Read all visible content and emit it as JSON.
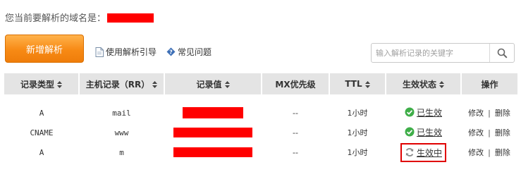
{
  "header": {
    "prompt": "您当前要解析的域名是："
  },
  "toolbar": {
    "add_label": "新增解析",
    "guide_label": "使用解析引导",
    "faq_label": "常见问题",
    "search_placeholder": "输入解析记录的关键字"
  },
  "table": {
    "columns": [
      "记录类型",
      "主机记录（RR）",
      "记录值",
      "MX优先级",
      "TTL",
      "生效状态",
      "操作"
    ],
    "rows": [
      {
        "type": "A",
        "host": "mail",
        "mx": "--",
        "ttl": "1小时",
        "status": "已生效",
        "edit": "修改",
        "divider": "|",
        "delete": "删除"
      },
      {
        "type": "CNAME",
        "host": "www",
        "mx": "--",
        "ttl": "1小时",
        "status": "已生效",
        "edit": "修改",
        "divider": "|",
        "delete": "删除"
      },
      {
        "type": "A",
        "host": "m",
        "mx": "--",
        "ttl": "1小时",
        "status": "生效中",
        "edit": "修改",
        "divider": "|",
        "delete": "删除"
      }
    ]
  },
  "colors": {
    "accent_orange": "#f78a15",
    "header_gray": "#e4e4e4",
    "redaction_red": "#ff0000",
    "status_ok_green": "#3fae49",
    "status_pending_gray": "#8a8a8a",
    "highlight_red": "#e00000"
  },
  "icons": {
    "add_button": "none",
    "guide": "document-icon",
    "faq": "question-diamond-icon",
    "search": "magnifier-icon",
    "sort": "sort-arrows-icon",
    "active_status": "check-circle-icon",
    "pending_status": "refresh-icon"
  }
}
